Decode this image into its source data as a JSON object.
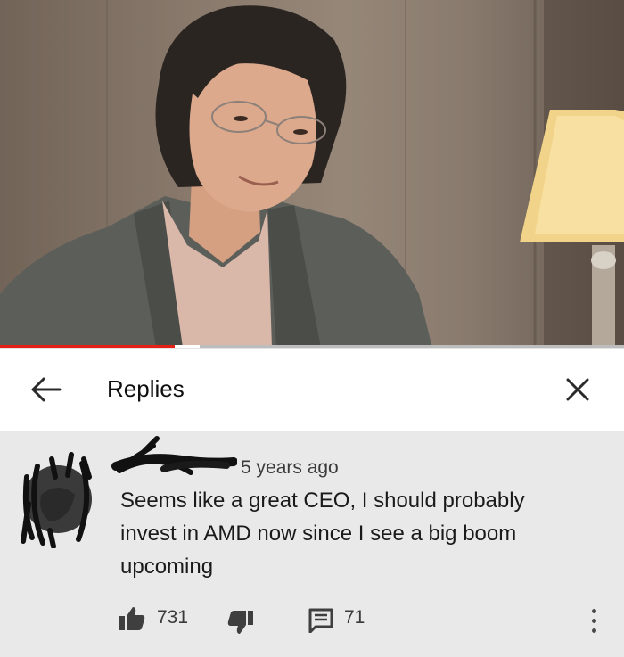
{
  "video": {
    "progress_fraction": 0.28,
    "buffered_fraction": 0.32,
    "progress_color": "#e52117"
  },
  "header": {
    "title": "Replies",
    "back_icon": "arrow-left-icon",
    "close_icon": "close-icon"
  },
  "comment": {
    "time": "5 years ago",
    "text": "Seems like a great CEO, I should probably invest in AMD now since I see a big boom upcoming",
    "like_count": "731",
    "reply_count": "71",
    "icons": {
      "like": "thumbs-up-icon",
      "dislike": "thumbs-down-icon",
      "reply": "comment-icon",
      "more": "more-vert-icon"
    }
  }
}
